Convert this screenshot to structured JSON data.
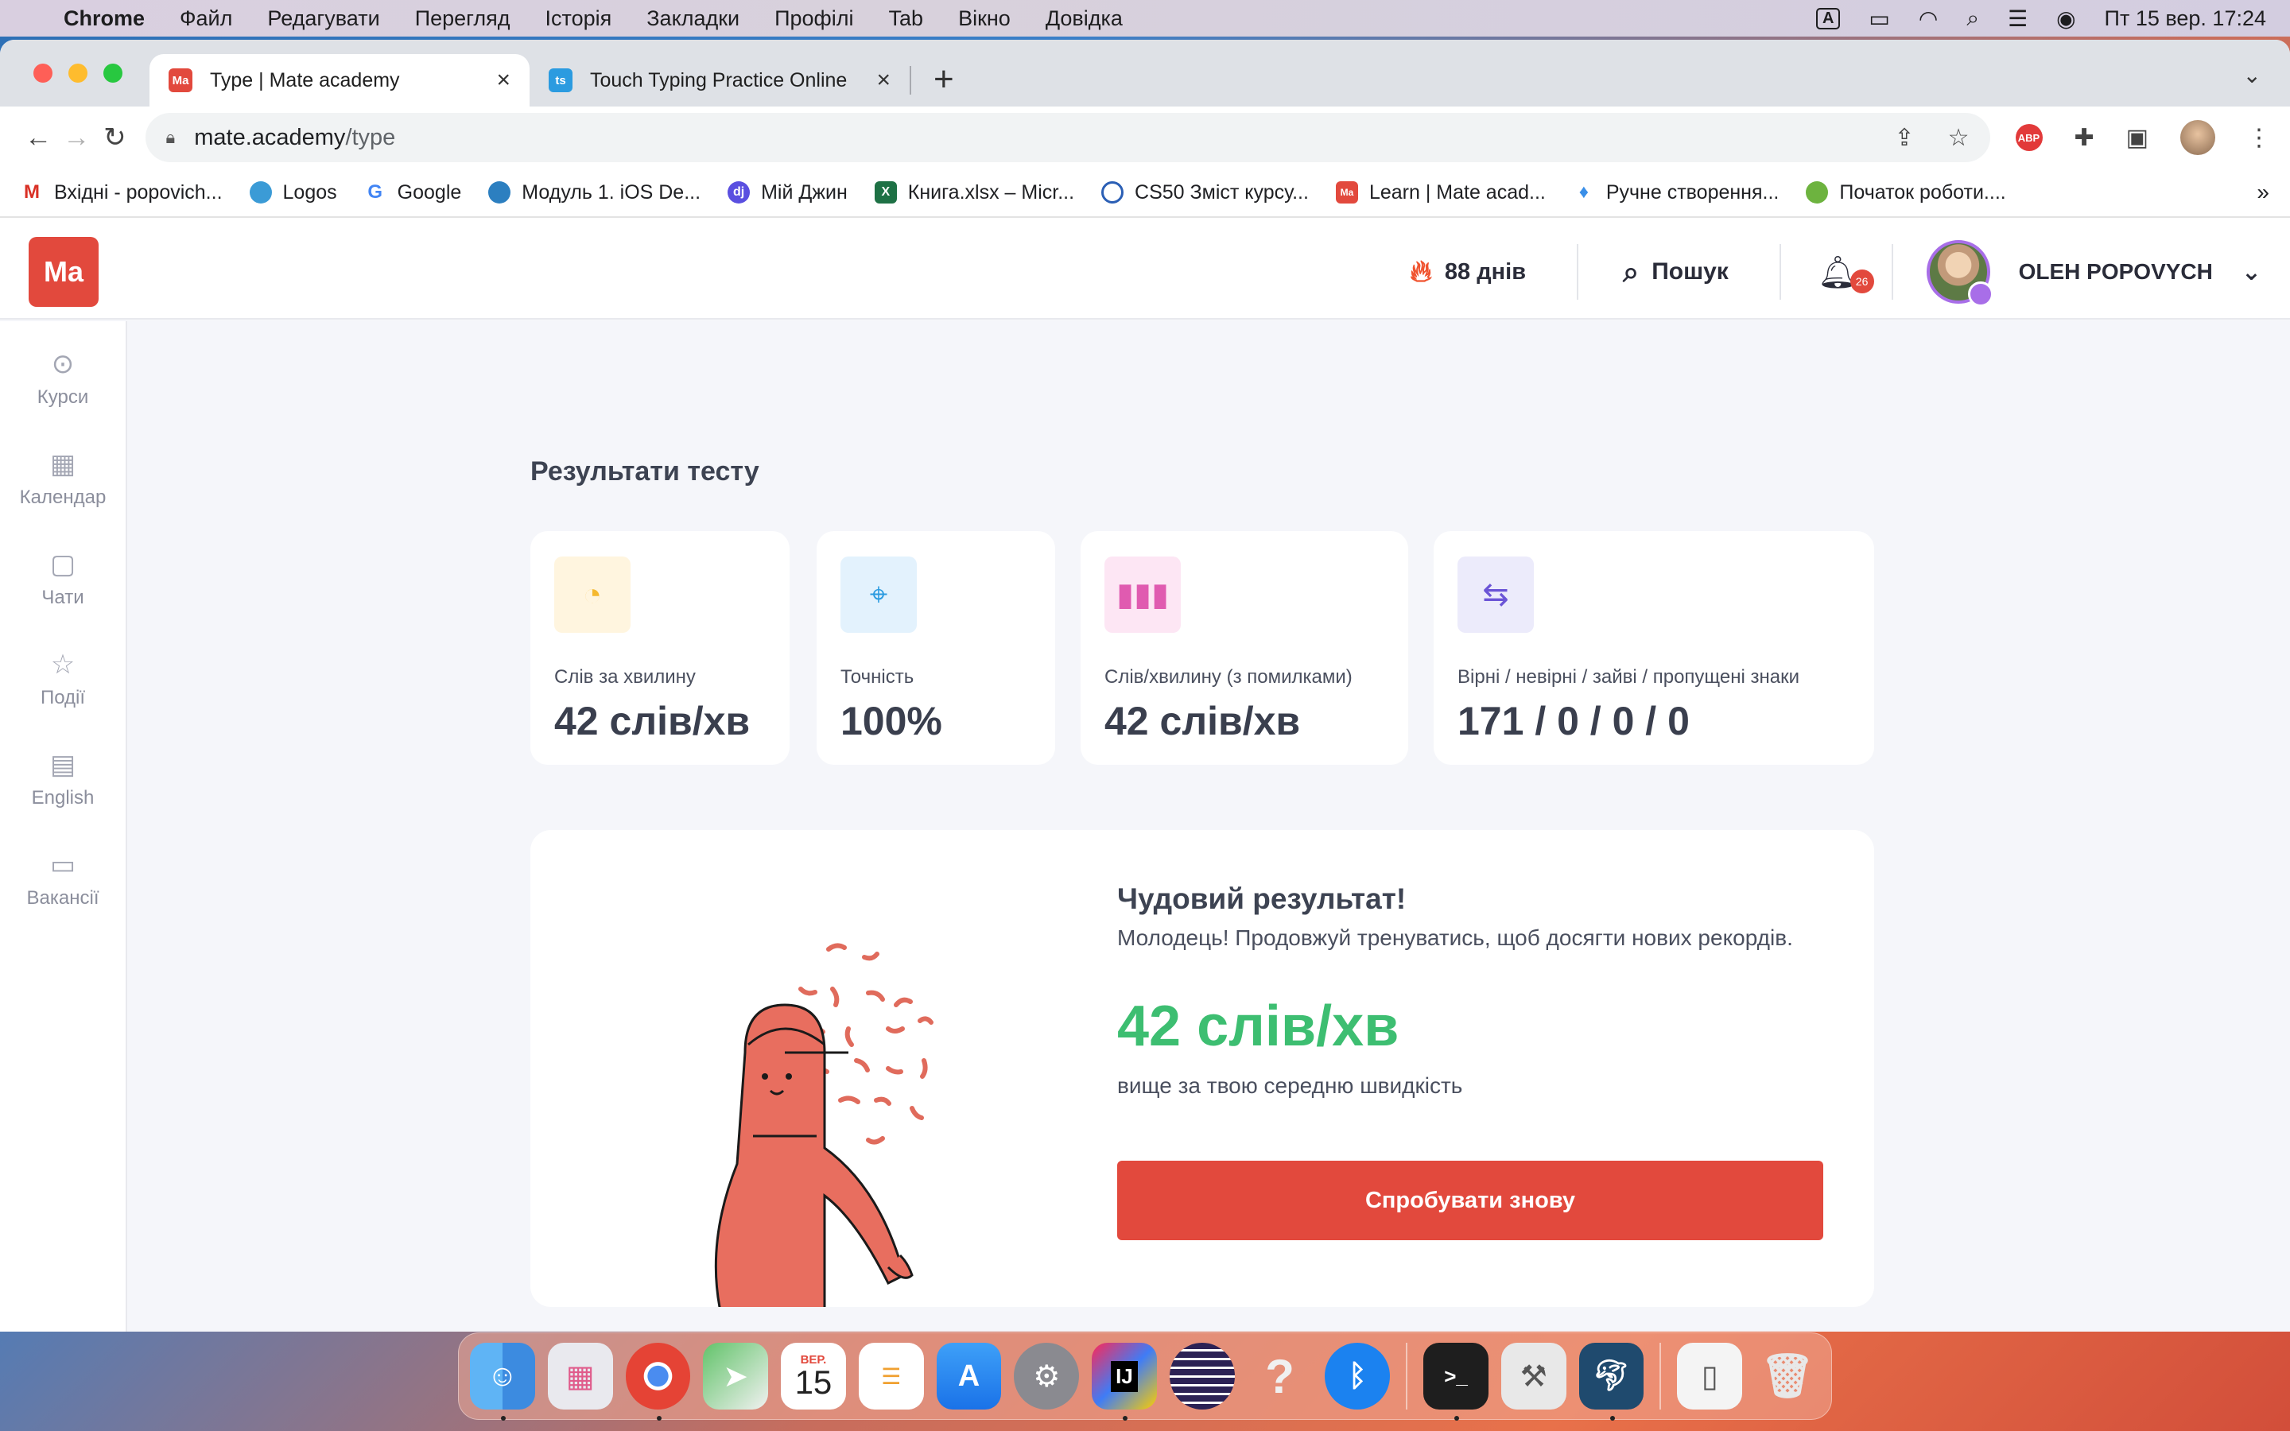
{
  "menubar": {
    "app": "Chrome",
    "items": [
      "Файл",
      "Редагувати",
      "Перегляд",
      "Історія",
      "Закладки",
      "Профілі",
      "Tab",
      "Вікно",
      "Довідка"
    ],
    "input_source": "A",
    "datetime": "Пт 15 вер.  17:24"
  },
  "browser": {
    "tabs": [
      {
        "title": "Type | Mate academy",
        "favicon": "Ma",
        "color": "#e2493d"
      },
      {
        "title": "Touch Typing Practice Online",
        "favicon": "ts",
        "color": "#2b9be0"
      }
    ],
    "url_host": "mate.academy",
    "url_path": "/type",
    "abp_label": "ABP",
    "bookmarks": [
      {
        "label": "Вхідні - popovich...",
        "icon": "gmail-icon"
      },
      {
        "label": "Logos",
        "icon": "logos-icon"
      },
      {
        "label": "Google",
        "icon": "google-icon"
      },
      {
        "label": "Модуль 1. iOS De...",
        "icon": "module-icon"
      },
      {
        "label": "Мій Джин",
        "icon": "djinni-icon"
      },
      {
        "label": "Книга.xlsx – Micr...",
        "icon": "excel-icon"
      },
      {
        "label": "CS50 Зміст курсу...",
        "icon": "cs50-icon"
      },
      {
        "label": "Learn | Mate acad...",
        "icon": "mate-icon"
      },
      {
        "label": "Ручне створення...",
        "icon": "ethereum-icon"
      },
      {
        "label": "Початок роботи....",
        "icon": "spring-icon"
      }
    ]
  },
  "header": {
    "logo": "Ma",
    "streak": "88 днів",
    "search": "Пошук",
    "notifications": "26",
    "user": "OLEH POPOVYCH"
  },
  "sidebar": {
    "items": [
      {
        "label": "Курси",
        "icon": "play-icon"
      },
      {
        "label": "Календар",
        "icon": "calendar-icon"
      },
      {
        "label": "Чати",
        "icon": "chat-icon"
      },
      {
        "label": "Події",
        "icon": "star-icon"
      },
      {
        "label": "English",
        "icon": "book-icon"
      },
      {
        "label": "Вакансії",
        "icon": "briefcase-icon"
      }
    ]
  },
  "results": {
    "title": "Результати тесту",
    "cards": [
      {
        "label": "Слів за хвилину",
        "value": "42 слів/хв",
        "icon": "speedometer-icon",
        "color": "#f5b82e"
      },
      {
        "label": "Точність",
        "value": "100%",
        "icon": "crosshair-icon",
        "color": "#2b9be0"
      },
      {
        "label": "Слів/хвилину (з помилками)",
        "value": "42 слів/хв",
        "icon": "bar-chart-icon",
        "color": "#e05bb0"
      },
      {
        "label": "Вірні / невірні / зайві / пропущені знаки",
        "value": "171 / 0 / 0 / 0",
        "icon": "swap-icon",
        "color": "#6b54d6"
      }
    ],
    "summary": {
      "heading": "Чудовий результат!",
      "subtitle": "Молодець! Продовжуй тренуватись, щоб досягти нових рекордів.",
      "value": "42 слів/хв",
      "comparison": "вище за твою середню швидкість",
      "button": "Спробувати знову"
    }
  },
  "dock": {
    "calendar_month": "ВЕР.",
    "calendar_day": "15"
  }
}
